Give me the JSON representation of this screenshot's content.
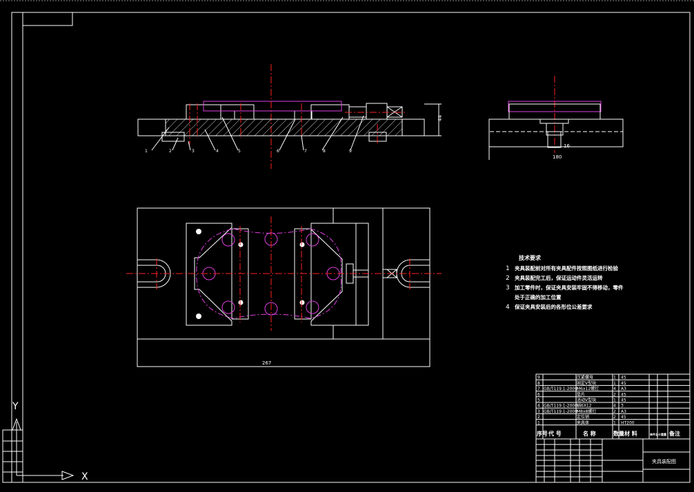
{
  "drawing": {
    "colors": {
      "background": "#000000",
      "outline": "#ffffff",
      "centerline": "#ff2020",
      "phantom": "#e040e0"
    },
    "part_labels": [
      "1",
      "2",
      "3",
      "4",
      "5",
      "6",
      "7",
      "8",
      "9"
    ],
    "dimensions": {
      "height": "44",
      "slot": "16",
      "side_width": "180",
      "length": "267"
    },
    "tech_requirements": {
      "title": "技术要求",
      "items": [
        {
          "num": "1",
          "text": "夹具装配前对所有夹具配件按照图纸进行检验"
        },
        {
          "num": "2",
          "text": "夹具装配完工后，保证运动件灵活运转"
        },
        {
          "num": "3",
          "text": "加工零件时，保证夹具安装牢固不得移动，零件"
        },
        {
          "num": "",
          "text": "处于正确的加工位置"
        },
        {
          "num": "4",
          "text": "保证夹具安装后的各形位公差要求"
        }
      ]
    },
    "bom": {
      "headers": [
        "序号",
        "代 号",
        "名 称",
        "数量",
        "材 料",
        "单件总计重量",
        "备注"
      ],
      "rows": [
        [
          "9",
          "",
          "压紧螺母",
          "1",
          "45"
        ],
        [
          "8",
          "",
          "固定V型块",
          "1",
          "45"
        ],
        [
          "7",
          "GB/T119.1-2000",
          "M6x12螺钉",
          "4",
          "A3"
        ],
        [
          "6",
          "",
          "垫片",
          "2",
          "45"
        ],
        [
          "5",
          "",
          "活动V型块",
          "1",
          "45"
        ],
        [
          "4",
          "GB/T119.1-2000",
          "销6X12",
          "4",
          "3"
        ],
        [
          "3",
          "GB/T119.1-2000",
          "M8x8螺钉",
          "2",
          "A3"
        ],
        [
          "2",
          "",
          "定位销",
          "2",
          "45"
        ],
        [
          "1",
          "",
          "夹具体",
          "1",
          "HT200"
        ]
      ]
    },
    "title_block": {
      "drawing_name": "夹具装配图"
    },
    "ucs": {
      "x_label": "X",
      "y_label": "Y"
    }
  }
}
